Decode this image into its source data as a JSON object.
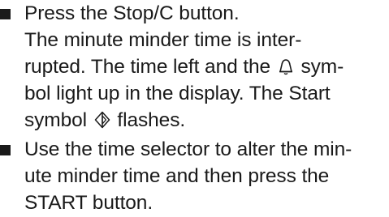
{
  "instructions": [
    {
      "lines": [
        "Press the Stop/C button.",
        "The minute minder time is inter-",
        [
          "rupted. The time left and the ",
          "bell-icon",
          " sym-"
        ],
        "bol light up in the display. The Start",
        [
          "symbol ",
          "start-symbol-icon",
          " flashes."
        ]
      ]
    },
    {
      "lines": [
        "Use the time selector to alter the min-",
        "ute minder time and then press the",
        "START button."
      ]
    }
  ],
  "icons": {
    "bell": "bell-icon",
    "start": "start-symbol-icon"
  },
  "colors": {
    "text": "#1a1a1a",
    "background": "#ffffff"
  }
}
